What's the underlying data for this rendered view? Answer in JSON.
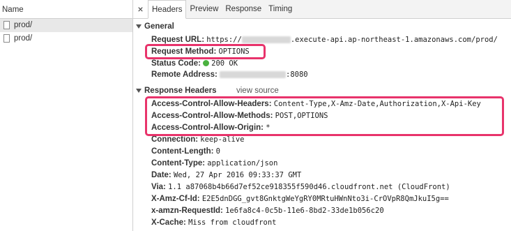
{
  "left_panel": {
    "header": "Name",
    "files": [
      {
        "name": "prod/",
        "selected": true
      },
      {
        "name": "prod/",
        "selected": false
      }
    ]
  },
  "tabs": {
    "close_icon": "close-icon",
    "items": [
      "Headers",
      "Preview",
      "Response",
      "Timing"
    ],
    "active": "Headers"
  },
  "general": {
    "title": "General",
    "request_url_key": "Request URL:",
    "request_url_prefix": "https://",
    "request_url_suffix": ".execute-api.ap-northeast-1.amazonaws.com/prod/",
    "request_method_key": "Request Method:",
    "request_method_val": "OPTIONS",
    "status_code_key": "Status Code:",
    "status_code_val": "200 OK",
    "status_color": "#4ab13f",
    "remote_address_key": "Remote Address:",
    "remote_address_suffix": ":8080"
  },
  "response_headers": {
    "title": "Response Headers",
    "view_source": "view source",
    "items": [
      {
        "key": "Access-Control-Allow-Headers:",
        "value": "Content-Type,X-Amz-Date,Authorization,X-Api-Key"
      },
      {
        "key": "Access-Control-Allow-Methods:",
        "value": "POST,OPTIONS"
      },
      {
        "key": "Access-Control-Allow-Origin:",
        "value": "*"
      },
      {
        "key": "Connection:",
        "value": "keep-alive"
      },
      {
        "key": "Content-Length:",
        "value": "0"
      },
      {
        "key": "Content-Type:",
        "value": "application/json"
      },
      {
        "key": "Date:",
        "value": "Wed, 27 Apr 2016 09:33:37 GMT"
      },
      {
        "key": "Via:",
        "value": "1.1 a87068b4b66d7ef52ce918355f590d46.cloudfront.net (CloudFront)"
      },
      {
        "key": "X-Amz-Cf-Id:",
        "value": "E2E5dnDGG_gvt8GnktgWeYgRY0MRtuHWnNto3i-CrOVpR8QmJkuI5g=="
      },
      {
        "key": "x-amzn-RequestId:",
        "value": "1e6fa8c4-0c5b-11e6-8bd2-33de1b056c20"
      },
      {
        "key": "X-Cache:",
        "value": "Miss from cloudfront"
      }
    ]
  },
  "highlight_color": "#e8336b"
}
